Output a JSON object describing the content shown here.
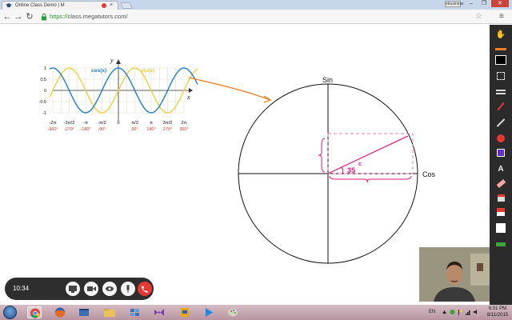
{
  "browser": {
    "tab_title": "Online Class Demo | M",
    "tab_close": "×",
    "user_badge": "ebusiness",
    "url_proto": "https://",
    "url_rest": "class.megatutors.com/",
    "window_controls": [
      "–",
      "❐",
      "✕"
    ]
  },
  "graph": {
    "y_axis": "y",
    "x_axis": "x",
    "y_ticks": [
      "1",
      "0.5",
      "0",
      "-0.5",
      "-1"
    ],
    "x_ticks_rad": [
      "-2π",
      "-3π/2",
      "-π",
      "-π/2",
      "0",
      "π/2",
      "π",
      "3π/2",
      "2π"
    ],
    "x_ticks_deg": [
      "-360°",
      "-270°",
      "-180°",
      "-90°",
      "90°",
      "180°",
      "270°",
      "360°"
    ],
    "cos_label": "cos(x)",
    "sin_label": "sin(x)",
    "colors": {
      "cos": "#1f7fc4",
      "sin": "#f0d040",
      "deg": "#d33a2c",
      "grid": "#e2dcc8"
    }
  },
  "circle": {
    "sin_label": "Sin",
    "cos_label": "Cos",
    "angle_label": "35",
    "degree_mark": "c",
    "colors": {
      "annotation": "#e2187a",
      "dashed": "#f07ac4",
      "arrow": "#ef7d22"
    }
  },
  "tools": [
    "hand-icon",
    "highlighter-icon",
    "black-swatch-icon",
    "select-icon",
    "lines-icon",
    "pen-icon",
    "line-icon",
    "circle-icon",
    "square-icon",
    "text-icon",
    "eraser-icon",
    "save-icon",
    "color-icon",
    "white-swatch-icon",
    "arrows-icon"
  ],
  "call": {
    "time": "10:34"
  },
  "taskbar": {
    "lang": "EN",
    "time": "6:01 PM",
    "date": "8/11/2015"
  }
}
